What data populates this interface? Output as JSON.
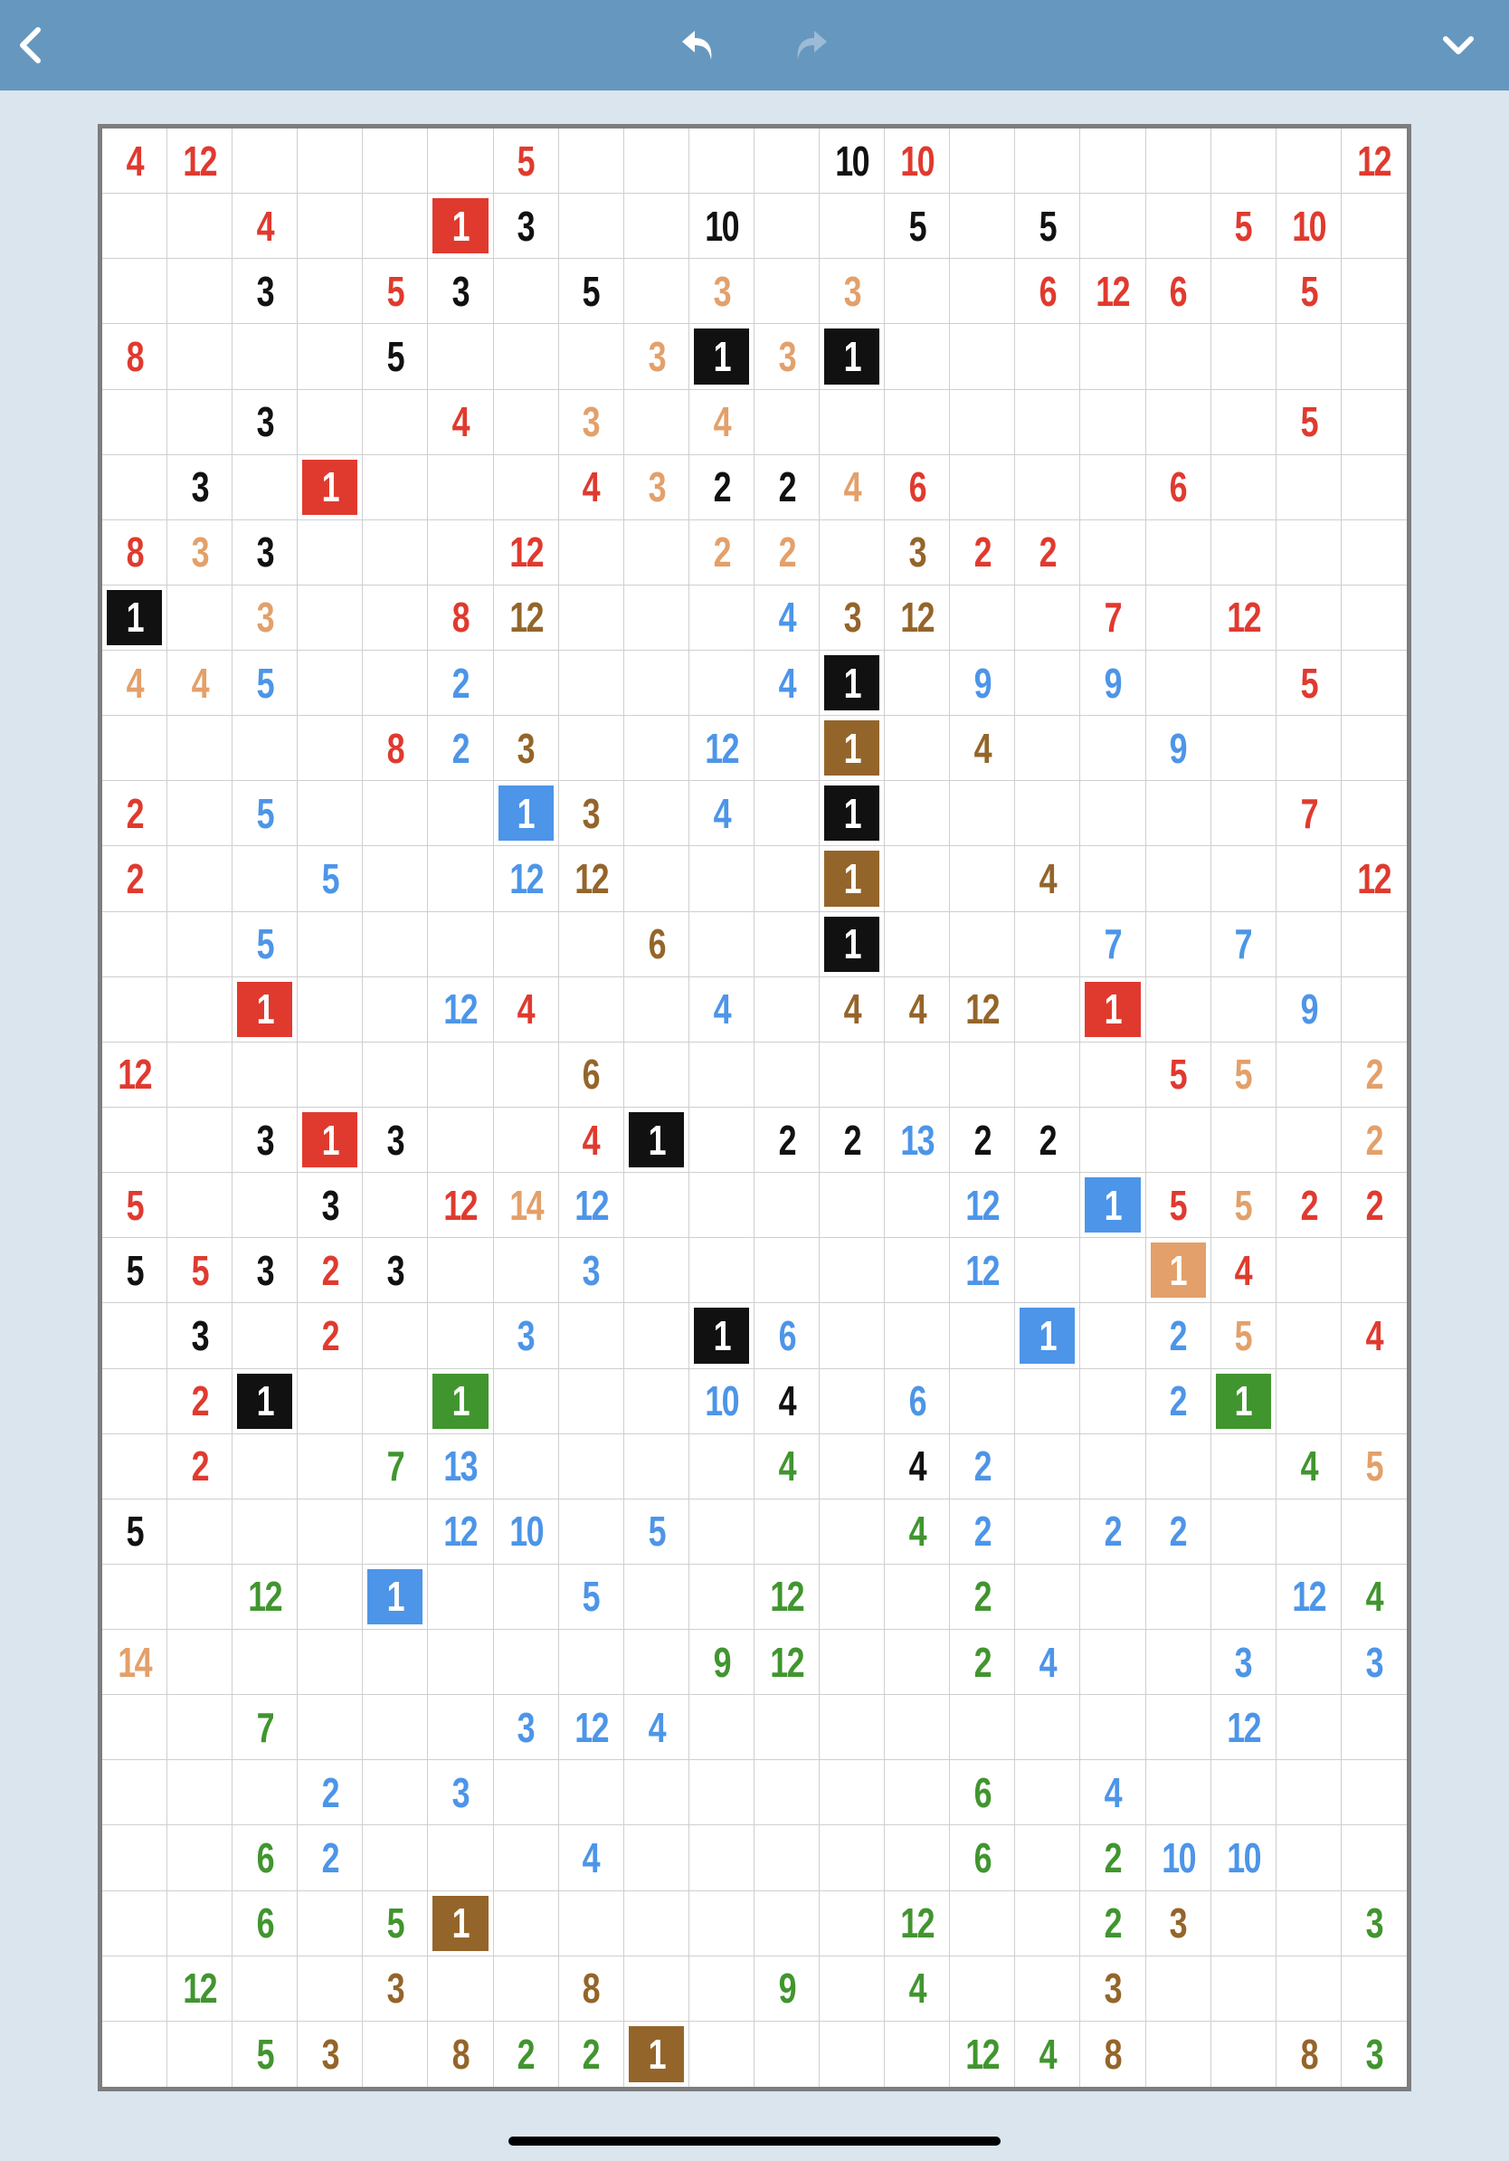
{
  "toolbar": {
    "back_icon": "chevron-left-icon",
    "undo_icon": "undo-icon",
    "redo_icon": "redo-icon",
    "menu_icon": "chevron-down-icon"
  },
  "palette": {
    "k": "#111111",
    "r": "#e03a2f",
    "o": "#e3a06a",
    "b": "#4d95e8",
    "n": "#94652a",
    "g": "#41952f"
  },
  "puzzle": {
    "cols": 20,
    "rows": 30,
    "clues": [
      [
        [
          0,
          "4",
          "r"
        ],
        [
          1,
          "12",
          "r"
        ],
        [
          6,
          "5",
          "r"
        ],
        [
          11,
          "10",
          "k"
        ],
        [
          12,
          "10",
          "r"
        ],
        [
          19,
          "12",
          "r"
        ]
      ],
      [
        [
          2,
          "4",
          "r"
        ],
        [
          5,
          "1",
          "r",
          1
        ],
        [
          6,
          "3",
          "k"
        ],
        [
          9,
          "10",
          "k"
        ],
        [
          12,
          "5",
          "k"
        ],
        [
          14,
          "5",
          "k"
        ],
        [
          17,
          "5",
          "r"
        ],
        [
          18,
          "10",
          "r"
        ]
      ],
      [
        [
          2,
          "3",
          "k"
        ],
        [
          4,
          "5",
          "r"
        ],
        [
          5,
          "3",
          "k"
        ],
        [
          7,
          "5",
          "k"
        ],
        [
          9,
          "3",
          "o"
        ],
        [
          11,
          "3",
          "o"
        ],
        [
          14,
          "6",
          "r"
        ],
        [
          15,
          "12",
          "r"
        ],
        [
          16,
          "6",
          "r"
        ],
        [
          18,
          "5",
          "r"
        ]
      ],
      [
        [
          0,
          "8",
          "r"
        ],
        [
          4,
          "5",
          "k"
        ],
        [
          8,
          "3",
          "o"
        ],
        [
          9,
          "1",
          "k",
          1
        ],
        [
          10,
          "3",
          "o"
        ],
        [
          11,
          "1",
          "k",
          1
        ]
      ],
      [
        [
          2,
          "3",
          "k"
        ],
        [
          5,
          "4",
          "r"
        ],
        [
          7,
          "3",
          "o"
        ],
        [
          9,
          "4",
          "o"
        ],
        [
          18,
          "5",
          "r"
        ]
      ],
      [
        [
          1,
          "3",
          "k"
        ],
        [
          3,
          "1",
          "r",
          1
        ],
        [
          7,
          "4",
          "r"
        ],
        [
          8,
          "3",
          "o"
        ],
        [
          9,
          "2",
          "k"
        ],
        [
          10,
          "2",
          "k"
        ],
        [
          11,
          "4",
          "o"
        ],
        [
          12,
          "6",
          "r"
        ],
        [
          16,
          "6",
          "r"
        ]
      ],
      [
        [
          0,
          "8",
          "r"
        ],
        [
          1,
          "3",
          "o"
        ],
        [
          2,
          "3",
          "k"
        ],
        [
          6,
          "12",
          "r"
        ],
        [
          9,
          "2",
          "o"
        ],
        [
          10,
          "2",
          "o"
        ],
        [
          12,
          "3",
          "n"
        ],
        [
          13,
          "2",
          "r"
        ],
        [
          14,
          "2",
          "r"
        ]
      ],
      [
        [
          0,
          "1",
          "k",
          1
        ],
        [
          2,
          "3",
          "o"
        ],
        [
          5,
          "8",
          "r"
        ],
        [
          6,
          "12",
          "n"
        ],
        [
          10,
          "4",
          "b"
        ],
        [
          11,
          "3",
          "n"
        ],
        [
          12,
          "12",
          "n"
        ],
        [
          15,
          "7",
          "r"
        ],
        [
          17,
          "12",
          "r"
        ]
      ],
      [
        [
          0,
          "4",
          "o"
        ],
        [
          1,
          "4",
          "o"
        ],
        [
          2,
          "5",
          "b"
        ],
        [
          5,
          "2",
          "b"
        ],
        [
          10,
          "4",
          "b"
        ],
        [
          11,
          "1",
          "k",
          1
        ],
        [
          13,
          "9",
          "b"
        ],
        [
          15,
          "9",
          "b"
        ],
        [
          18,
          "5",
          "r"
        ]
      ],
      [
        [
          4,
          "8",
          "r"
        ],
        [
          5,
          "2",
          "b"
        ],
        [
          6,
          "3",
          "n"
        ],
        [
          9,
          "12",
          "b"
        ],
        [
          11,
          "1",
          "n",
          1
        ],
        [
          13,
          "4",
          "n"
        ],
        [
          16,
          "9",
          "b"
        ]
      ],
      [
        [
          0,
          "2",
          "r"
        ],
        [
          2,
          "5",
          "b"
        ],
        [
          6,
          "1",
          "b",
          1
        ],
        [
          7,
          "3",
          "n"
        ],
        [
          9,
          "4",
          "b"
        ],
        [
          11,
          "1",
          "k",
          1
        ],
        [
          18,
          "7",
          "r"
        ]
      ],
      [
        [
          0,
          "2",
          "r"
        ],
        [
          3,
          "5",
          "b"
        ],
        [
          6,
          "12",
          "b"
        ],
        [
          7,
          "12",
          "n"
        ],
        [
          11,
          "1",
          "n",
          1
        ],
        [
          14,
          "4",
          "n"
        ],
        [
          19,
          "12",
          "r"
        ]
      ],
      [
        [
          2,
          "5",
          "b"
        ],
        [
          8,
          "6",
          "n"
        ],
        [
          11,
          "1",
          "k",
          1
        ],
        [
          15,
          "7",
          "b"
        ],
        [
          17,
          "7",
          "b"
        ]
      ],
      [
        [
          2,
          "1",
          "r",
          1
        ],
        [
          5,
          "12",
          "b"
        ],
        [
          6,
          "4",
          "r"
        ],
        [
          9,
          "4",
          "b"
        ],
        [
          11,
          "4",
          "n"
        ],
        [
          12,
          "4",
          "n"
        ],
        [
          13,
          "12",
          "n"
        ],
        [
          15,
          "1",
          "r",
          1
        ],
        [
          18,
          "9",
          "b"
        ]
      ],
      [
        [
          0,
          "12",
          "r"
        ],
        [
          7,
          "6",
          "n"
        ],
        [
          16,
          "5",
          "r"
        ],
        [
          17,
          "5",
          "o"
        ],
        [
          19,
          "2",
          "o"
        ]
      ],
      [
        [
          2,
          "3",
          "k"
        ],
        [
          3,
          "1",
          "r",
          1
        ],
        [
          4,
          "3",
          "k"
        ],
        [
          7,
          "4",
          "r"
        ],
        [
          8,
          "1",
          "k",
          1
        ],
        [
          10,
          "2",
          "k"
        ],
        [
          11,
          "2",
          "k"
        ],
        [
          12,
          "13",
          "b"
        ],
        [
          13,
          "2",
          "k"
        ],
        [
          14,
          "2",
          "k"
        ],
        [
          19,
          "2",
          "o"
        ]
      ],
      [
        [
          0,
          "5",
          "r"
        ],
        [
          3,
          "3",
          "k"
        ],
        [
          5,
          "12",
          "r"
        ],
        [
          6,
          "14",
          "o"
        ],
        [
          7,
          "12",
          "b"
        ],
        [
          13,
          "12",
          "b"
        ],
        [
          15,
          "1",
          "b",
          1
        ],
        [
          16,
          "5",
          "r"
        ],
        [
          17,
          "5",
          "o"
        ],
        [
          18,
          "2",
          "r"
        ],
        [
          19,
          "2",
          "r"
        ]
      ],
      [
        [
          0,
          "5",
          "k"
        ],
        [
          1,
          "5",
          "r"
        ],
        [
          2,
          "3",
          "k"
        ],
        [
          3,
          "2",
          "r"
        ],
        [
          4,
          "3",
          "k"
        ],
        [
          7,
          "3",
          "b"
        ],
        [
          13,
          "12",
          "b"
        ],
        [
          16,
          "1",
          "o",
          1
        ],
        [
          17,
          "4",
          "r"
        ]
      ],
      [
        [
          1,
          "3",
          "k"
        ],
        [
          3,
          "2",
          "r"
        ],
        [
          6,
          "3",
          "b"
        ],
        [
          9,
          "1",
          "k",
          1
        ],
        [
          10,
          "6",
          "b"
        ],
        [
          14,
          "1",
          "b",
          1
        ],
        [
          16,
          "2",
          "b"
        ],
        [
          17,
          "5",
          "o"
        ],
        [
          19,
          "4",
          "r"
        ]
      ],
      [
        [
          1,
          "2",
          "r"
        ],
        [
          2,
          "1",
          "k",
          1
        ],
        [
          5,
          "1",
          "g",
          1
        ],
        [
          9,
          "10",
          "b"
        ],
        [
          10,
          "4",
          "k"
        ],
        [
          12,
          "6",
          "b"
        ],
        [
          16,
          "2",
          "b"
        ],
        [
          17,
          "1",
          "g",
          1
        ]
      ],
      [
        [
          1,
          "2",
          "r"
        ],
        [
          4,
          "7",
          "g"
        ],
        [
          5,
          "13",
          "b"
        ],
        [
          10,
          "4",
          "g"
        ],
        [
          12,
          "4",
          "k"
        ],
        [
          13,
          "2",
          "b"
        ],
        [
          18,
          "4",
          "g"
        ],
        [
          19,
          "5",
          "o"
        ]
      ],
      [
        [
          0,
          "5",
          "k"
        ],
        [
          5,
          "12",
          "b"
        ],
        [
          6,
          "10",
          "b"
        ],
        [
          8,
          "5",
          "b"
        ],
        [
          12,
          "4",
          "g"
        ],
        [
          13,
          "2",
          "b"
        ],
        [
          15,
          "2",
          "b"
        ],
        [
          16,
          "2",
          "b"
        ]
      ],
      [
        [
          2,
          "12",
          "g"
        ],
        [
          4,
          "1",
          "b",
          1
        ],
        [
          7,
          "5",
          "b"
        ],
        [
          10,
          "12",
          "g"
        ],
        [
          13,
          "2",
          "g"
        ],
        [
          18,
          "12",
          "b"
        ],
        [
          19,
          "4",
          "g"
        ]
      ],
      [
        [
          0,
          "14",
          "o"
        ],
        [
          9,
          "9",
          "g"
        ],
        [
          10,
          "12",
          "g"
        ],
        [
          13,
          "2",
          "g"
        ],
        [
          14,
          "4",
          "b"
        ],
        [
          17,
          "3",
          "b"
        ],
        [
          19,
          "3",
          "b"
        ]
      ],
      [
        [
          2,
          "7",
          "g"
        ],
        [
          6,
          "3",
          "b"
        ],
        [
          7,
          "12",
          "b"
        ],
        [
          8,
          "4",
          "b"
        ],
        [
          17,
          "12",
          "b"
        ]
      ],
      [
        [
          3,
          "2",
          "b"
        ],
        [
          5,
          "3",
          "b"
        ],
        [
          13,
          "6",
          "g"
        ],
        [
          15,
          "4",
          "b"
        ]
      ],
      [
        [
          2,
          "6",
          "g"
        ],
        [
          3,
          "2",
          "b"
        ],
        [
          7,
          "4",
          "b"
        ],
        [
          13,
          "6",
          "g"
        ],
        [
          15,
          "2",
          "g"
        ],
        [
          16,
          "10",
          "b"
        ],
        [
          17,
          "10",
          "b"
        ]
      ],
      [
        [
          2,
          "6",
          "g"
        ],
        [
          4,
          "5",
          "g"
        ],
        [
          5,
          "1",
          "n",
          1
        ],
        [
          12,
          "12",
          "g"
        ],
        [
          15,
          "2",
          "g"
        ],
        [
          16,
          "3",
          "n"
        ],
        [
          19,
          "3",
          "g"
        ]
      ],
      [
        [
          1,
          "12",
          "g"
        ],
        [
          4,
          "3",
          "n"
        ],
        [
          7,
          "8",
          "n"
        ],
        [
          10,
          "9",
          "g"
        ],
        [
          12,
          "4",
          "g"
        ],
        [
          15,
          "3",
          "n"
        ]
      ],
      [
        [
          2,
          "5",
          "g"
        ],
        [
          3,
          "3",
          "n"
        ],
        [
          5,
          "8",
          "n"
        ],
        [
          6,
          "2",
          "g"
        ],
        [
          7,
          "2",
          "g"
        ],
        [
          8,
          "1",
          "n",
          1
        ],
        [
          13,
          "12",
          "g"
        ],
        [
          14,
          "4",
          "g"
        ],
        [
          15,
          "8",
          "n"
        ],
        [
          18,
          "8",
          "n"
        ],
        [
          19,
          "3",
          "g"
        ]
      ]
    ]
  }
}
